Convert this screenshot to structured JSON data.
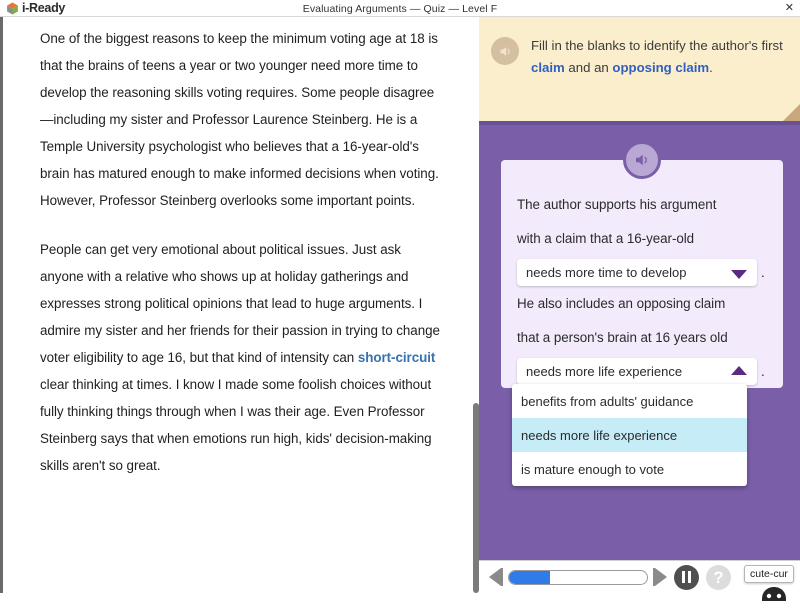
{
  "topbar": {
    "logo_text": "i-Ready",
    "logo_icon": "cube-logo-icon",
    "title": "Evaluating Arguments — Quiz — Level F",
    "close_label": "✕"
  },
  "reading": {
    "paragraph1_pre": "One of the biggest reasons to keep the minimum voting age at 18 is that the brains of teens a year or two younger need more time to develop the reasoning skills voting requires. Some people disagree—including my sister and Professor Laurence Steinberg. He is a Temple University psychologist who believes that a 16-year-old's brain has matured enough to make informed decisions when voting. However, Professor Steinberg overlooks some important points.",
    "paragraph2_pre": "People can get very emotional about political issues. Just ask anyone with a relative who shows up at holiday gatherings and expresses strong political opinions that lead to huge arguments. I admire my sister and her friends for their passion in trying to change voter eligibility to age 16, but that kind of intensity can ",
    "paragraph2_keyword": "short-circuit",
    "paragraph2_post": " clear thinking at times. I know I made some foolish choices without fully thinking things through when I was their age. Even Professor Steinberg says that when emotions run high, kids' decision-making skills aren't so great."
  },
  "instruction": {
    "speaker_icon": "speaker-icon",
    "text_pre": "Fill in the blanks to identify the author's first ",
    "keyword1": "claim",
    "text_mid": " and an ",
    "keyword2": "opposing claim",
    "text_post": "."
  },
  "question": {
    "speaker_icon": "speaker-icon",
    "line1": "The author supports his argument",
    "line2": "with a claim that a 16-year-old",
    "line3": "He also includes an opposing claim",
    "line4": "that a person's brain at 16 years old",
    "period": ".",
    "dropdown1": {
      "value": "needs more time to develop",
      "state": "closed",
      "caret_icon": "chevron-down-icon"
    },
    "dropdown2": {
      "value": "needs more life experience",
      "state": "open",
      "caret_icon": "chevron-up-icon",
      "options": [
        "benefits from adults' guidance",
        "needs more life experience",
        "is mature enough to vote"
      ],
      "selected_index": 1
    }
  },
  "toolbar": {
    "prev_icon": "skip-previous-icon",
    "next_icon": "skip-next-icon",
    "pause_icon": "pause-icon",
    "help_icon": "help-question-icon",
    "help_label": "?",
    "progress_percent": 30,
    "tooltip_text": "cute-cur",
    "cursor_icon": "cursor-badge-icon"
  },
  "colors": {
    "panel_purple": "#7a5fa8",
    "card_lavender": "#f3ebfb",
    "instruction_cream": "#faeecd",
    "keyword_blue": "#3572b0",
    "highlight_cyan": "#c5ecf7",
    "progress_blue": "#2f7ce8",
    "caret_purple": "#5b2a82"
  }
}
